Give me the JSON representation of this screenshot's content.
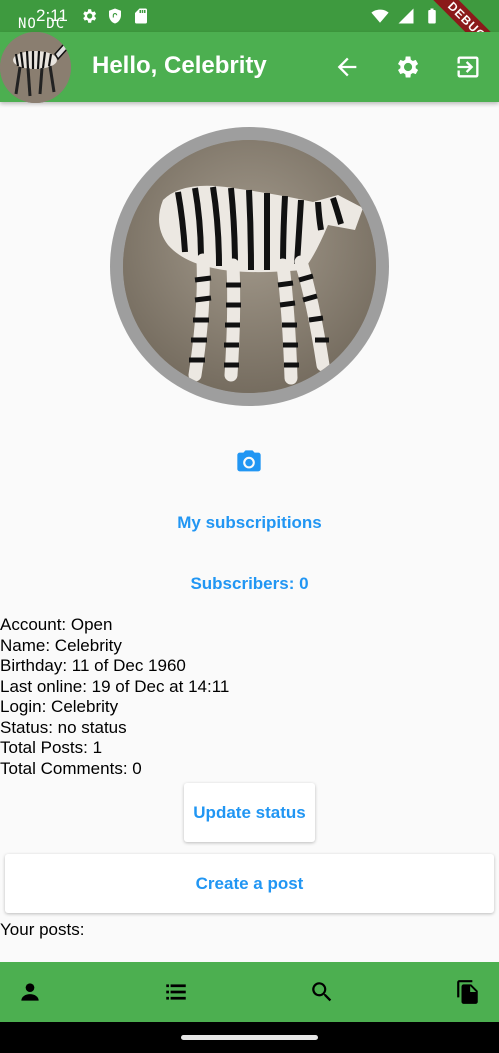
{
  "status_bar": {
    "time": "2:11",
    "watermark": "NO DC",
    "debug_label": "DEBUG",
    "icons_left": [
      "settings-icon",
      "shield-icon",
      "sd-card-icon"
    ],
    "icons_right": [
      "wifi-icon",
      "signal-icon",
      "battery-icon"
    ]
  },
  "app_bar": {
    "title": "Hello, Celebrity",
    "avatar_subject": "zebra",
    "actions": [
      "back-arrow-icon",
      "gear-icon",
      "logout-icon"
    ],
    "color": "#4caf50"
  },
  "profile": {
    "photo_subject": "zebra",
    "ring_color": "#9e9e9e",
    "camera_icon": "camera-icon",
    "subscriptions_label": "My subscripitions",
    "subscribers_label": "Subscribers: 0"
  },
  "info": {
    "account": "Account: Open",
    "name": "Name: Celebrity",
    "birthday": "Birthday: 11 of Dec 1960",
    "last_online": "Last online: 19 of Dec at 14:11",
    "login": "Login: Celebrity",
    "status": "Status: no status",
    "total_posts": "Total Posts: 1",
    "total_comments": "Total Comments: 0"
  },
  "actions": {
    "update_status": "Update status",
    "create_post": "Create a post",
    "your_posts": "Your posts:"
  },
  "bottom_nav": {
    "items": [
      "person-icon",
      "list-icon",
      "search-icon",
      "documents-icon"
    ]
  },
  "colors": {
    "accent": "#2196f3",
    "primary": "#4caf50",
    "status_bar": "#3e9a3f"
  }
}
